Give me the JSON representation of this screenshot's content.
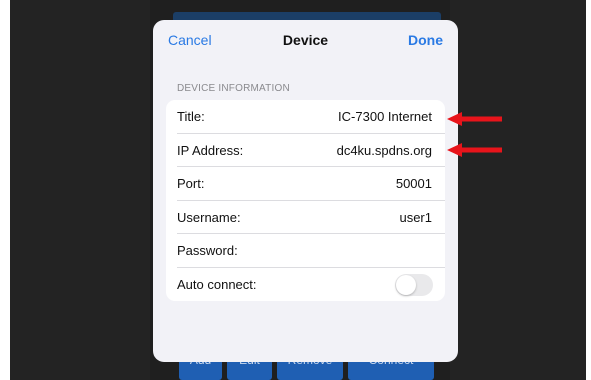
{
  "colors": {
    "accent": "#2a7ae4",
    "annotation_arrow": "#e8141b",
    "backdrop": "#232323",
    "sheet_background": "#f2f2f7"
  },
  "background_buttons": [
    "Add",
    "Edit",
    "Remove",
    "Connect"
  ],
  "nav": {
    "cancel_label": "Cancel",
    "title": "Device",
    "done_label": "Done"
  },
  "section": {
    "header": "DEVICE INFORMATION"
  },
  "fields": {
    "title": {
      "label": "Title:",
      "value": "IC-7300 Internet"
    },
    "ip_address": {
      "label": "IP Address:",
      "value": "dc4ku.spdns.org"
    },
    "port": {
      "label": "Port:",
      "value": "50001"
    },
    "username": {
      "label": "Username:",
      "value": "user1"
    },
    "password": {
      "label": "Password:",
      "value": ""
    },
    "auto_connect": {
      "label": "Auto connect:",
      "on": false
    }
  },
  "annotations": {
    "arrow_icon": "left-arrow-icon"
  }
}
